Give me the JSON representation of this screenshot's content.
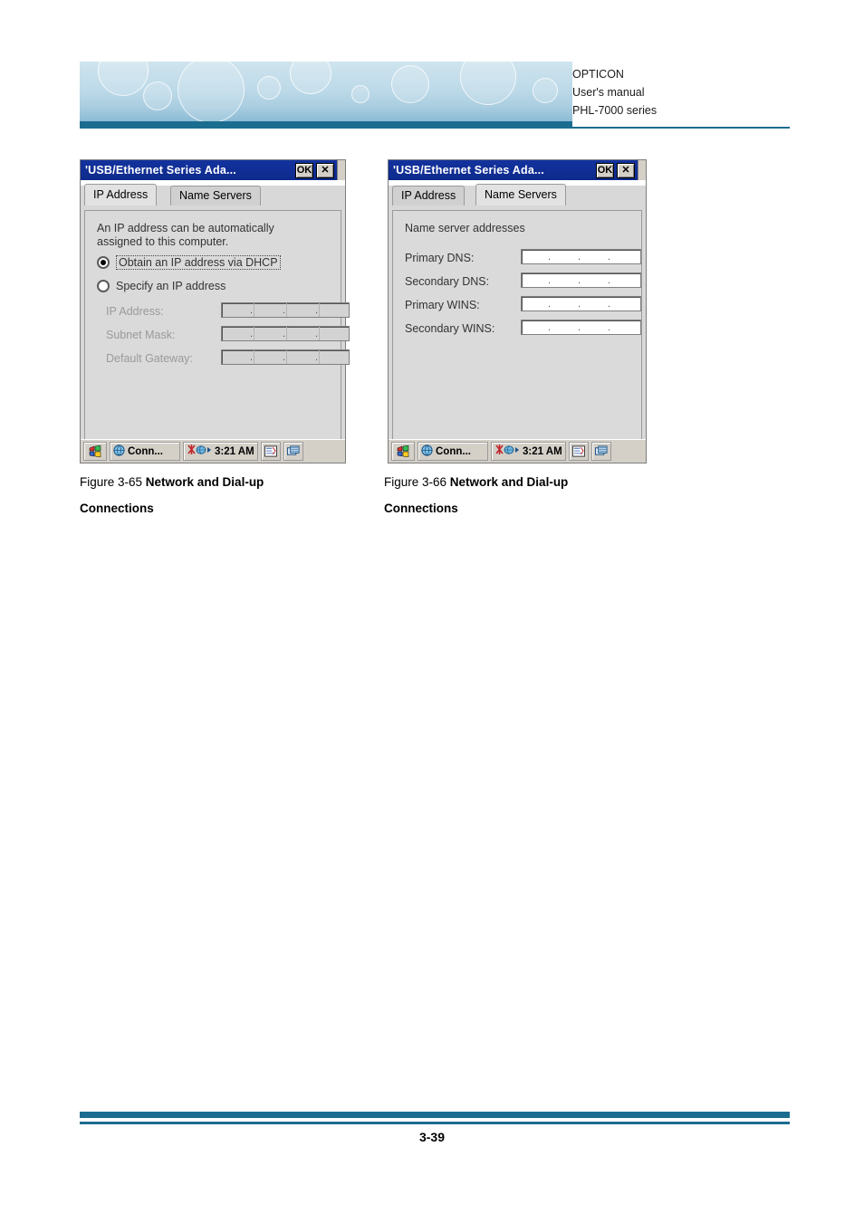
{
  "header": {
    "line1": "OPTICON",
    "line2": "User's manual",
    "line3": "PHL-7000 series"
  },
  "footer": {
    "page_number": "3-39"
  },
  "dialog_left": {
    "title": "'USB/Ethernet Series Ada...",
    "ok_label": "OK",
    "close_label": "✕",
    "tabs": [
      {
        "label": "IP Address",
        "active": true
      },
      {
        "label": "Name Servers",
        "active": false
      }
    ],
    "description_line1": "An IP address can be automatically",
    "description_line2": "assigned to this computer.",
    "radio_dhcp": "Obtain an IP address via DHCP",
    "radio_static": "Specify an IP address",
    "fields": [
      {
        "label": "IP Address:",
        "value": ""
      },
      {
        "label": "Subnet Mask:",
        "value": ""
      },
      {
        "label": "Default Gateway:",
        "value": ""
      }
    ],
    "taskbar": {
      "start_icon": "windows-start-icon",
      "conn_label": "Conn...",
      "conn_icon": "globe-icon",
      "net_icon": "network-icon",
      "clock": "3:21 AM",
      "keyboard_icon": "keyboard-icon",
      "desktop_icon": "desktop-icon"
    }
  },
  "dialog_right": {
    "title": "'USB/Ethernet Series Ada...",
    "ok_label": "OK",
    "close_label": "✕",
    "tabs": [
      {
        "label": "IP Address",
        "active": false
      },
      {
        "label": "Name Servers",
        "active": true
      }
    ],
    "group_label": "Name server addresses",
    "fields": [
      {
        "label": "Primary DNS:",
        "value": ""
      },
      {
        "label": "Secondary DNS:",
        "value": ""
      },
      {
        "label": "Primary WINS:",
        "value": ""
      },
      {
        "label": "Secondary WINS:",
        "value": ""
      }
    ],
    "taskbar": {
      "start_icon": "windows-start-icon",
      "conn_label": "Conn...",
      "conn_icon": "globe-icon",
      "net_icon": "network-icon",
      "clock": "3:21 AM",
      "keyboard_icon": "keyboard-icon",
      "desktop_icon": "desktop-icon"
    }
  },
  "captions": {
    "left_prefix": "Figure 3-65 ",
    "left_bold1": "Network and Dial-up",
    "left_bold2": "Connections",
    "right_prefix": "Figure 3-66 ",
    "right_bold1": "Network and Dial-up",
    "right_bold2": "Connections"
  },
  "colors": {
    "accent": "#1b6d8f",
    "titlebar": "#12329e",
    "panel": "#dadada"
  }
}
